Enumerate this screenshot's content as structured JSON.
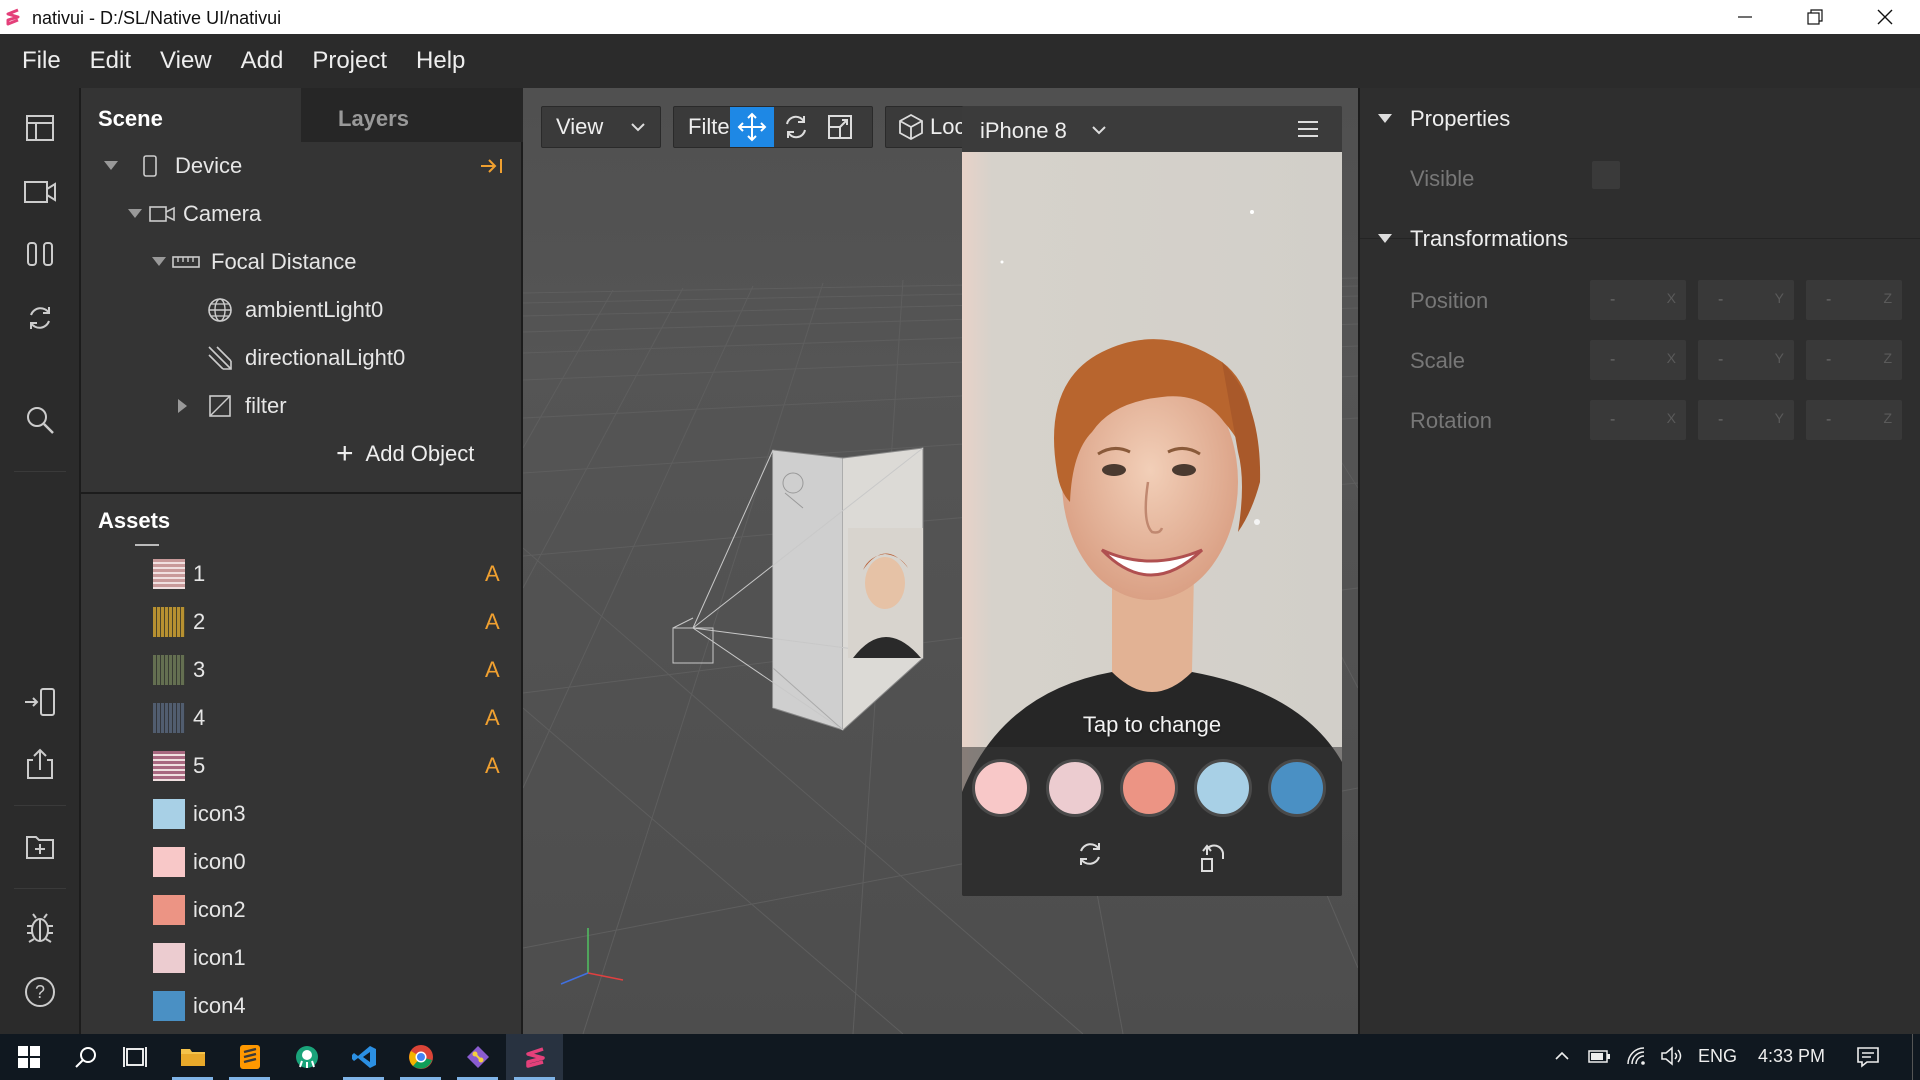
{
  "window": {
    "title": "nativui - D:/SL/Native UI/nativui"
  },
  "menu": [
    "File",
    "Edit",
    "View",
    "Add",
    "Project",
    "Help"
  ],
  "scene_panel": {
    "tabs": [
      "Scene",
      "Layers"
    ],
    "tree": [
      {
        "label": "Device",
        "icon": "phone-icon",
        "expanded": true
      },
      {
        "label": "Camera",
        "icon": "camera-icon",
        "expanded": true
      },
      {
        "label": "Focal Distance",
        "icon": "ruler-icon",
        "expanded": true
      },
      {
        "label": "ambientLight0",
        "icon": "globe-icon"
      },
      {
        "label": "directionalLight0",
        "icon": "directional-light-icon"
      },
      {
        "label": "filter",
        "icon": "plane-icon",
        "expanded": false
      }
    ],
    "add_object_label": "Add Object"
  },
  "assets_panel": {
    "title": "Assets",
    "items": [
      {
        "label": "1",
        "thumb": "striped",
        "color": "#c89a9a",
        "flag": "A"
      },
      {
        "label": "2",
        "thumb": "grid",
        "color": "#d8c070",
        "flag": "A"
      },
      {
        "label": "3",
        "thumb": "grid",
        "color": "#a0a890",
        "flag": "A"
      },
      {
        "label": "4",
        "thumb": "grid",
        "color": "#909aa8",
        "flag": "A"
      },
      {
        "label": "5",
        "thumb": "striped",
        "color": "#a86880",
        "flag": "A"
      },
      {
        "label": "icon3",
        "thumb": "solid",
        "color": "#a8d0e6",
        "flag": ""
      },
      {
        "label": "icon0",
        "thumb": "solid",
        "color": "#f8c8c8",
        "flag": ""
      },
      {
        "label": "icon2",
        "thumb": "solid",
        "color": "#ec9484",
        "flag": ""
      },
      {
        "label": "icon1",
        "thumb": "solid",
        "color": "#ecccd0",
        "flag": ""
      },
      {
        "label": "icon4",
        "thumb": "solid",
        "color": "#4a90c4",
        "flag": ""
      }
    ]
  },
  "viewport": {
    "view_label": "View",
    "filter_label": "Filter",
    "local_label": "Local",
    "active_tool": "move"
  },
  "phone": {
    "device_name": "iPhone 8",
    "tap_label": "Tap to change",
    "swatches": [
      "#f8c8c8",
      "#ecccd0",
      "#ec9484",
      "#a8d0e6",
      "#4a90c4"
    ]
  },
  "properties": {
    "properties_title": "Properties",
    "visible_label": "Visible",
    "visible_checked": false,
    "transformations_title": "Transformations",
    "rows": [
      {
        "label": "Position",
        "x": "-",
        "y": "-",
        "z": "-"
      },
      {
        "label": "Scale",
        "x": "-",
        "y": "-",
        "z": "-"
      },
      {
        "label": "Rotation",
        "x": "-",
        "y": "-",
        "z": "-"
      }
    ],
    "axes": [
      "X",
      "Y",
      "Z"
    ]
  },
  "taskbar": {
    "language": "ENG",
    "time": "4:33 PM"
  },
  "colors": {
    "accent": "#1e88e5",
    "warning_flag": "#f0a030"
  }
}
